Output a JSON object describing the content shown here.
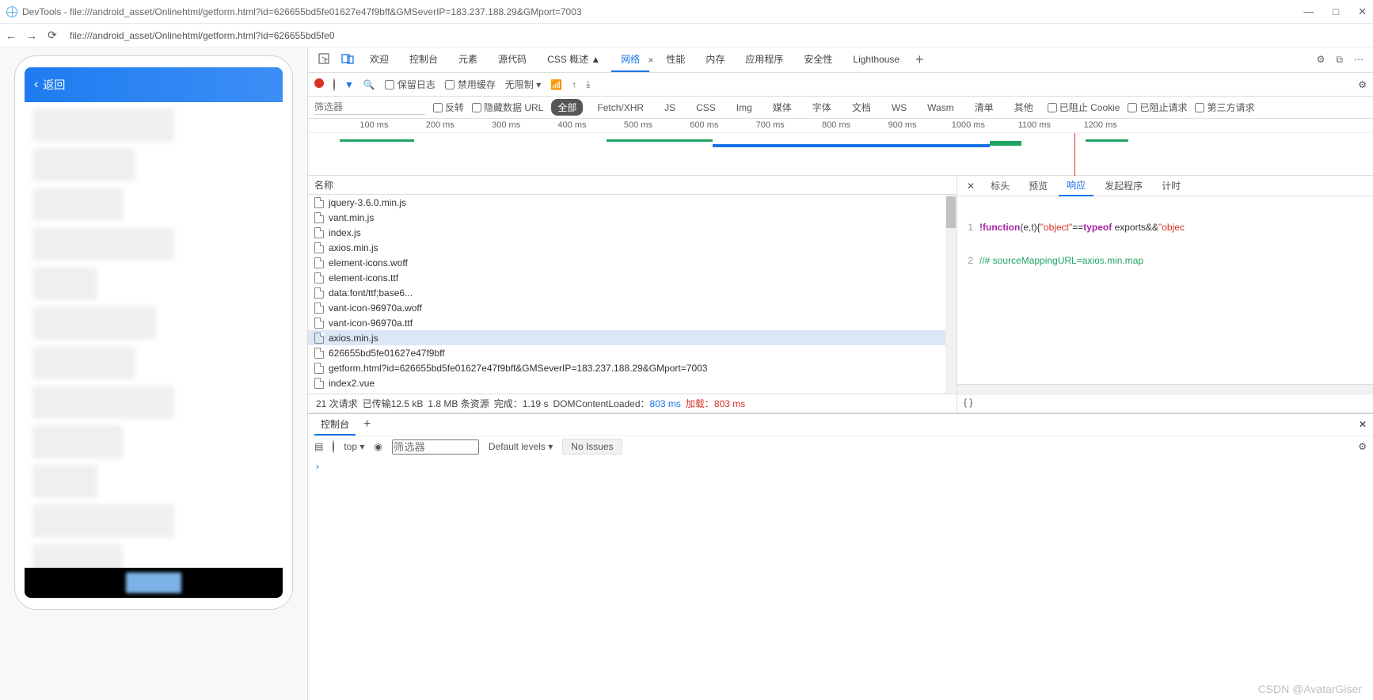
{
  "window": {
    "title": "DevTools - file:///android_asset/Onlinehtml/getform.html?id=626655bd5fe01627e47f9bff&GMSeverIP=183.237.188.29&GMport=7003",
    "min": "—",
    "max": "□",
    "close": "✕"
  },
  "address": {
    "url": "file:///android_asset/Onlinehtml/getform.html?id=626655bd5fe0"
  },
  "device": {
    "back_label": "返回"
  },
  "tabs": {
    "welcome": "欢迎",
    "console": "控制台",
    "elements": "元素",
    "sources": "源代码",
    "css": "CSS 概述 ▲",
    "network": "网络",
    "performance": "性能",
    "memory": "内存",
    "application": "应用程序",
    "security": "安全性",
    "lighthouse": "Lighthouse"
  },
  "toolbar": {
    "preserve": "保留日志",
    "disable_cache": "禁用缓存",
    "throttle": "无限制",
    "arrow": "▾"
  },
  "filter": {
    "placeholder": "筛选器",
    "invert": "反转",
    "hide_data": "隐藏数据 URL",
    "all": "全部",
    "fetch": "Fetch/XHR",
    "js": "JS",
    "css": "CSS",
    "img": "Img",
    "media": "媒体",
    "font": "字体",
    "doc": "文档",
    "ws": "WS",
    "wasm": "Wasm",
    "manifest": "清单",
    "other": "其他",
    "blocked_cookies": "已阻止 Cookie",
    "blocked_req": "已阻止请求",
    "third": "第三方请求"
  },
  "overview": {
    "ticks": [
      "100 ms",
      "200 ms",
      "300 ms",
      "400 ms",
      "500 ms",
      "600 ms",
      "700 ms",
      "800 ms",
      "900 ms",
      "1000 ms",
      "1100 ms",
      "1200 ms"
    ]
  },
  "netlist": {
    "header": "名称",
    "rows": [
      "jquery-3.6.0.min.js",
      "vant.min.js",
      "index.js",
      "axios.min.js",
      "element-icons.woff",
      "element-icons.ttf",
      "data:font/ttf;base6...",
      "vant-icon-96970a.woff",
      "vant-icon-96970a.ttf",
      "axios.min.js",
      "626655bd5fe01627e47f9bff",
      "getform.html?id=626655bd5fe01627e47f9bff&GMSeverIP=183.237.188.29&GMport=7003",
      "index2.vue"
    ],
    "selected_index": 9
  },
  "status": {
    "requests": "21 次请求",
    "transfer": "已传输12.5 kB",
    "resources": "1.8 MB 条资源",
    "finish": "完成：1.19 s",
    "dcl_label": "DOMContentLoaded：",
    "dcl_val": "803 ms",
    "load_label": "加载：",
    "load_val": "803 ms"
  },
  "detail": {
    "tabs": {
      "headers": "标头",
      "preview": "预览",
      "response": "响应",
      "initiator": "发起程序",
      "timing": "计时"
    },
    "code_line1_kw": "!function",
    "code_line1_rest": "(e,t){",
    "code_line1_str1": "\"object\"",
    "code_line1_eq": "==",
    "code_line1_typeof": "typeof",
    "code_line1_exp": " exports&&",
    "code_line1_str2": "\"objec",
    "code_line2": "//# sourceMappingURL=axios.min.map",
    "brace": "{ }"
  },
  "consoleDrawer": {
    "tab": "控制台",
    "top": "top",
    "default_levels": "Default levels",
    "no_issues": "No Issues",
    "filter_ph": "筛选器"
  },
  "watermark": "CSDN @AvatarGiser"
}
